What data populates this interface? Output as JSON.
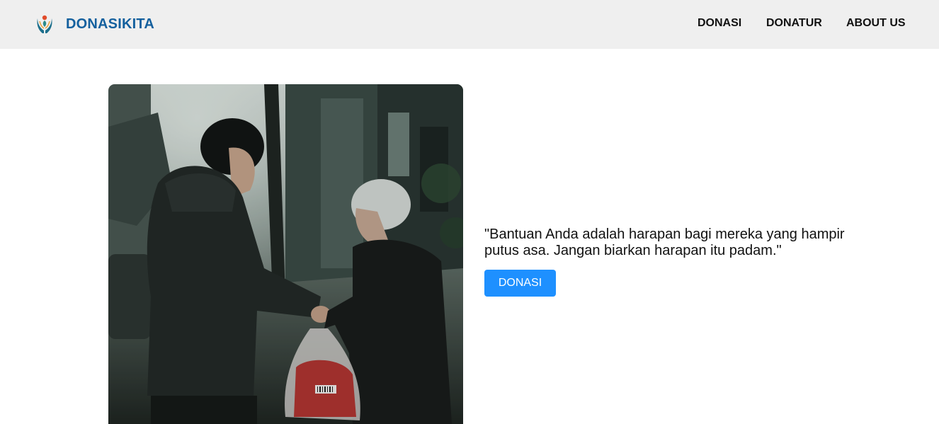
{
  "header": {
    "brand_name": "DONASIKITA",
    "logo_icon": "hands-heart-logo-icon",
    "nav": [
      {
        "label": "DONASI"
      },
      {
        "label": "DONATUR"
      },
      {
        "label": "ABOUT US"
      }
    ]
  },
  "hero": {
    "image_icon": "donation-photo",
    "quote": "\"Bantuan Anda adalah harapan bagi mereka yang hampir putus asa. Jangan biarkan harapan itu padam.\"",
    "cta_label": "DONASI"
  },
  "colors": {
    "navbar_bg": "#efefef",
    "brand": "#14609e",
    "button_bg": "#1e90ff",
    "button_text": "#ffffff"
  }
}
